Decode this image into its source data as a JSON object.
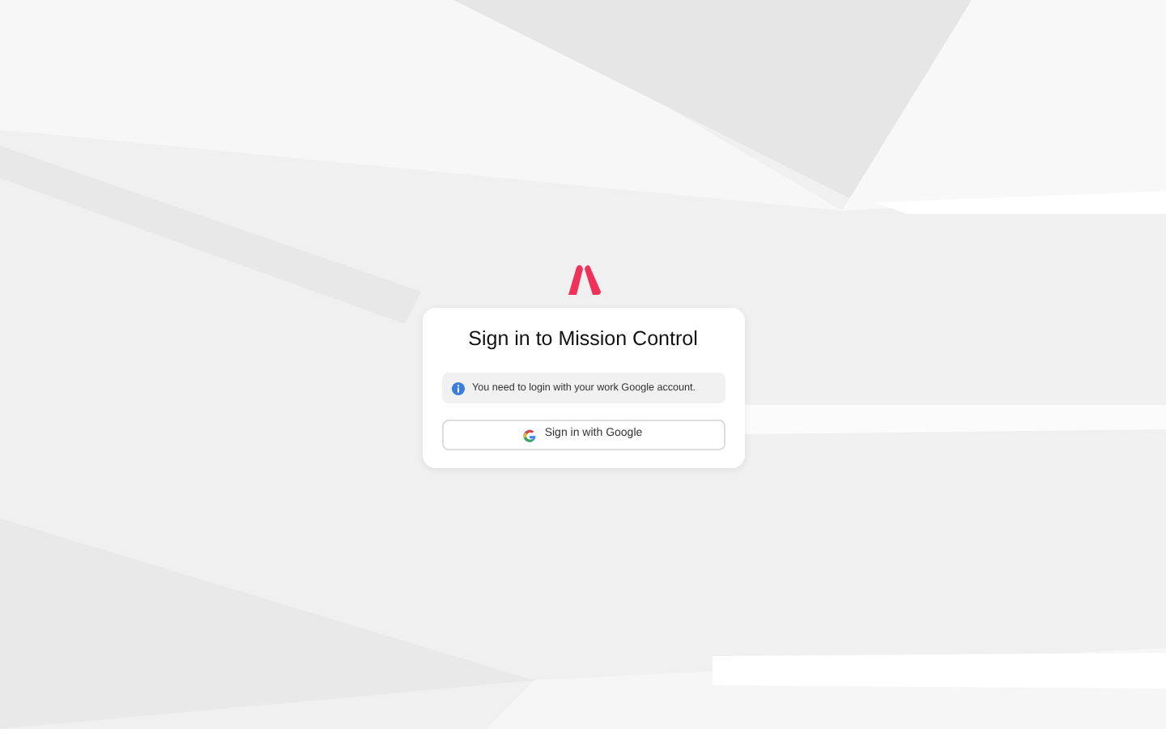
{
  "title": "Sign in to Mission Control",
  "notice": {
    "text": "You need to login with your work Google account."
  },
  "button": {
    "label": "Sign in with Google"
  }
}
